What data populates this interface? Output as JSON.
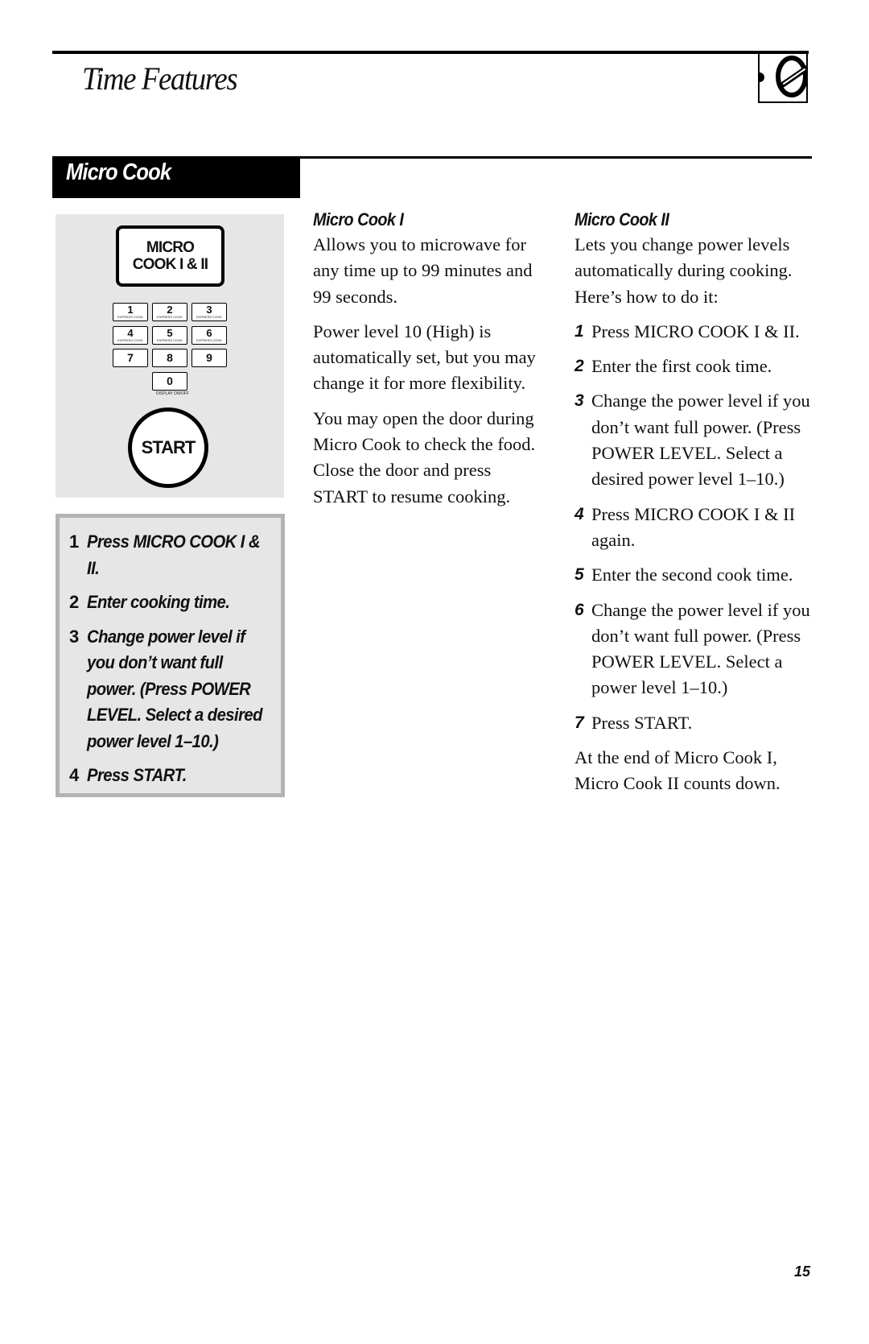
{
  "header": {
    "title": "Time Features",
    "chapter_icon": "clock-dial-icon"
  },
  "section": {
    "title": "Micro Cook"
  },
  "keypad": {
    "micro_cook_button": [
      "MICRO",
      "COOK I & II"
    ],
    "keys": [
      {
        "num": "1",
        "sub": "EXPRESS COOK"
      },
      {
        "num": "2",
        "sub": "EXPRESS COOK"
      },
      {
        "num": "3",
        "sub": "EXPRESS COOK"
      },
      {
        "num": "4",
        "sub": "EXPRESS COOK"
      },
      {
        "num": "5",
        "sub": "EXPRESS COOK"
      },
      {
        "num": "6",
        "sub": "EXPRESS COOK"
      },
      {
        "num": "7",
        "sub": ""
      },
      {
        "num": "8",
        "sub": ""
      },
      {
        "num": "9",
        "sub": ""
      },
      {
        "num": "0",
        "sub": ""
      }
    ],
    "zero_caption": "DISPLAY ON/OFF",
    "start_label": "START"
  },
  "quick_steps": [
    {
      "n": "1",
      "text": "Press MICRO COOK I & II."
    },
    {
      "n": "2",
      "text": "Enter cooking time."
    },
    {
      "n": "3",
      "text": "Change power level if you don’t want full power. (Press POWER LEVEL. Select a desired power level 1–10.)"
    },
    {
      "n": "4",
      "text": "Press START."
    }
  ],
  "micro_cook_1": {
    "heading": "Micro Cook I",
    "paragraphs": [
      "Allows you to microwave for any time up to 99 minutes and 99 seconds.",
      "Power level 10 (High) is automatically set, but you may change it for more flexibility.",
      "You may open the door during Micro Cook to check the food. Close the door and press START to resume cooking."
    ]
  },
  "micro_cook_2": {
    "heading": "Micro Cook II",
    "intro": "Lets you change power levels automatically during cooking. Here’s how to do it:",
    "steps": [
      {
        "n": "1",
        "text": "Press MICRO COOK I & II."
      },
      {
        "n": "2",
        "text": "Enter the first cook time."
      },
      {
        "n": "3",
        "text": "Change the power level if you don’t want full power. (Press POWER LEVEL. Select a desired power level 1–10.)"
      },
      {
        "n": "4",
        "text": "Press MICRO COOK I & II again."
      },
      {
        "n": "5",
        "text": "Enter the second cook time."
      },
      {
        "n": "6",
        "text": "Change the power level if you don’t want full power. (Press POWER LEVEL. Select a power level 1–10.)"
      },
      {
        "n": "7",
        "text": "Press START."
      }
    ],
    "closing": "At the end of Micro Cook I, Micro Cook II counts down."
  },
  "footer": {
    "page_number": "15"
  }
}
